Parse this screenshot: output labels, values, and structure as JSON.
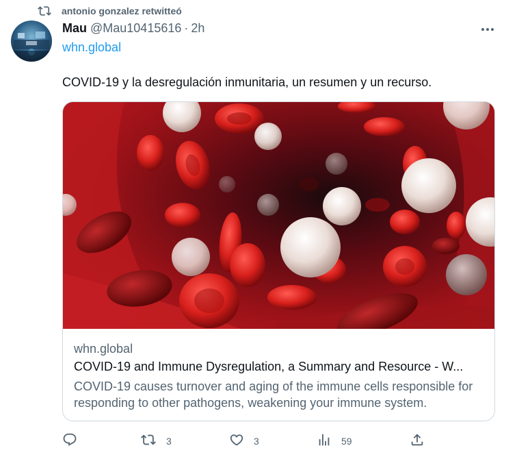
{
  "retweet": {
    "label": "antonio gonzalez retwitteó",
    "icon": "retweet-icon"
  },
  "author": {
    "name": "Mau",
    "handle": "@Mau10415616",
    "separator": "·",
    "time": "2h",
    "avatar_icon": "avatar-image"
  },
  "tweet": {
    "link": "whn.global",
    "text": "COVID-19 y la desregulación inmunitaria, un resumen y un recurso."
  },
  "card": {
    "image": "blood-cells-illustration",
    "domain": "whn.global",
    "title": "COVID-19 and Immune Dysregulation, a Summary and Resource - W...",
    "description": "COVID-19 causes turnover and aging of the immune cells responsible for responding to other pathogens, weakening your immune system."
  },
  "actions": {
    "reply": {
      "icon": "reply-icon",
      "count": ""
    },
    "retweet": {
      "icon": "retweet-icon",
      "count": "3"
    },
    "like": {
      "icon": "heart-icon",
      "count": "3"
    },
    "views": {
      "icon": "views-icon",
      "count": "59"
    },
    "share": {
      "icon": "share-icon",
      "count": ""
    }
  },
  "colors": {
    "link": "#1d9bf0",
    "secondary_text": "#536471",
    "primary_text": "#0f1419",
    "border": "#cfd9de"
  }
}
